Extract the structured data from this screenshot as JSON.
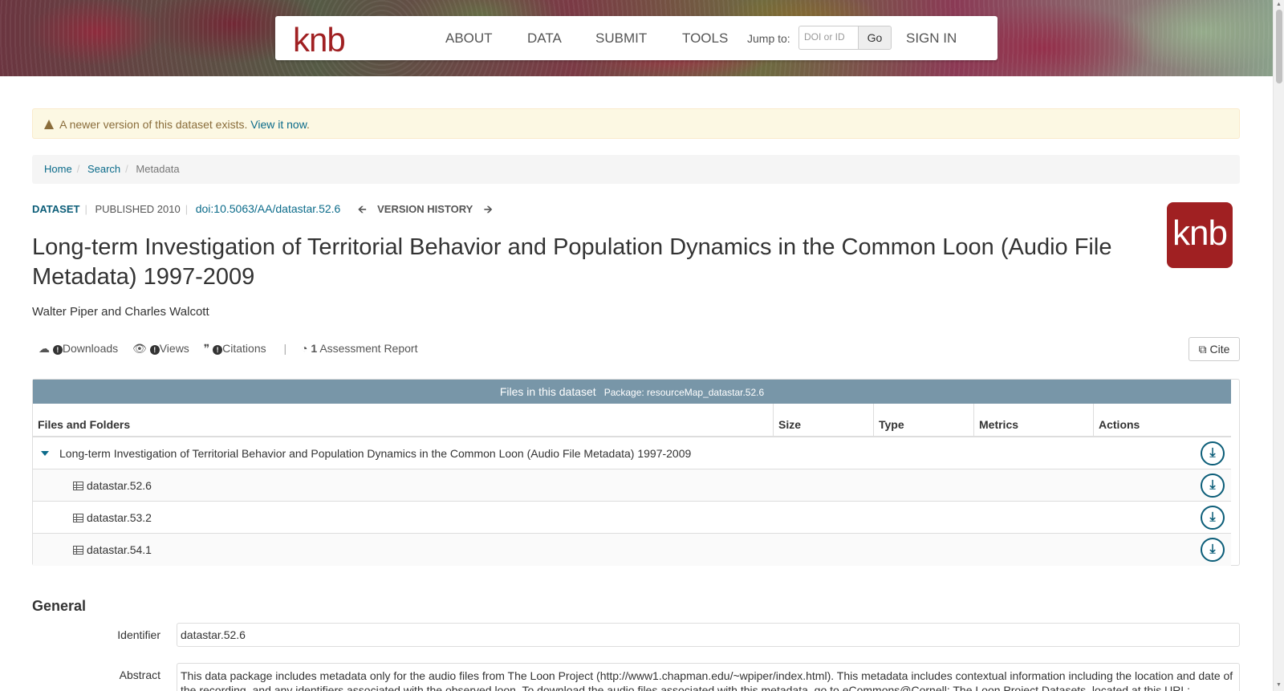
{
  "nav": {
    "logo": "knb",
    "items": [
      "ABOUT",
      "DATA",
      "SUBMIT",
      "TOOLS"
    ],
    "jump_label": "Jump to:",
    "jump_placeholder": "DOI or ID",
    "go": "Go",
    "sign_in": "SIGN IN"
  },
  "alert": {
    "text": "A newer version of this dataset exists.",
    "link": "View it now",
    "after": "."
  },
  "breadcrumb": [
    "Home",
    "Search",
    "Metadata"
  ],
  "dataset": {
    "kind": "DATASET",
    "published": "PUBLISHED 2010",
    "doi": "doi:10.5063/AA/datastar.52.6",
    "version_history": "VERSION HISTORY",
    "title": "Long-term Investigation of Territorial Behavior and Population Dynamics in the Common Loon (Audio File Metadata) 1997-2009",
    "authors": "Walter Piper and Charles Walcott",
    "logo_text": "knb"
  },
  "metrics": {
    "downloads": "Downloads",
    "views": "Views",
    "citations": "Citations",
    "assessment_count": "1",
    "assessment": "Assessment Report",
    "cite": "Cite"
  },
  "files": {
    "header": "Files in this dataset",
    "package": "Package: resourceMap_datastar.52.6",
    "columns": [
      "Files and Folders",
      "Size",
      "Type",
      "Metrics",
      "Actions"
    ],
    "root": "Long-term Investigation of Territorial Behavior and Population Dynamics in the Common Loon (Audio File Metadata) 1997-2009",
    "items": [
      "datastar.52.6",
      "datastar.53.2",
      "datastar.54.1"
    ]
  },
  "general": {
    "heading": "General",
    "identifier_label": "Identifier",
    "identifier": "datastar.52.6",
    "abstract_label": "Abstract",
    "abstract": "This data package includes metadata only for the audio files from The Loon Project (http://www1.chapman.edu/~wpiper/index.html). This metadata includes contextual information including the location and date of the recording, and any identifiers associated with the observed loon. To download the audio files associated with this metadata, go to eCommons@Cornell: The Loon Project Datasets, located at this URL:"
  },
  "colors": {
    "brand": "#a02022",
    "link": "#0b6b8a",
    "table_header": "#7896a8",
    "alert_bg": "#fcf8e3"
  }
}
